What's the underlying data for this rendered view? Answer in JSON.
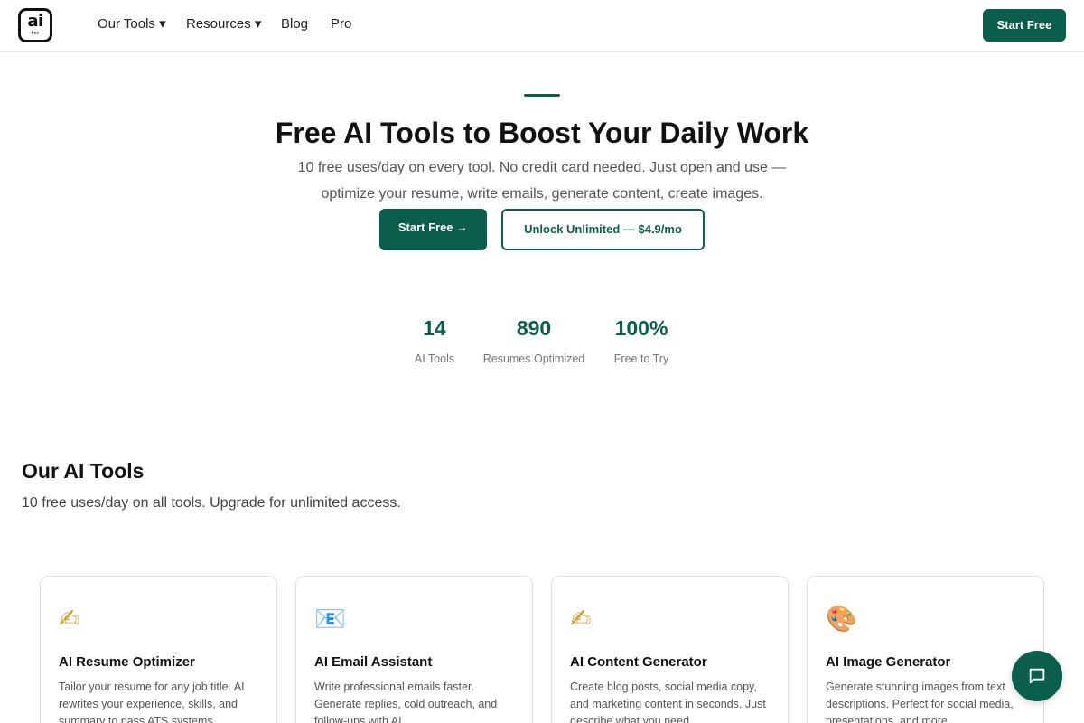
{
  "brand": {
    "logo_text": "ai",
    "logo_sub": "free"
  },
  "nav": {
    "items": [
      {
        "label": "Our Tools ▾"
      },
      {
        "label": "Resources ▾"
      },
      {
        "label": "Blog"
      },
      {
        "label": "Pro"
      }
    ],
    "cta_label": "Start Free"
  },
  "hero": {
    "title": "Free AI Tools to Boost Your Daily Work",
    "subtitle_line1": "10 free uses/day on every tool. No credit card needed. Just open and use —",
    "subtitle_line2": "optimize your resume, write emails, generate content, create images.",
    "primary_label": "Start Free →",
    "secondary_label": "Unlock Unlimited — $4.9/mo"
  },
  "stats": [
    {
      "value": "14",
      "label": "AI Tools"
    },
    {
      "value": "890",
      "label": "Resumes Optimized"
    },
    {
      "value": "100%",
      "label": "Free to Try"
    }
  ],
  "tools_section": {
    "title": "Our AI Tools",
    "subtitle": "10 free uses/day on all tools. Upgrade for unlimited access."
  },
  "cards": [
    {
      "icon": "writing-hand-icon",
      "glyph": "✍",
      "title": "AI Resume Optimizer",
      "desc": "Tailor your resume for any job title. AI rewrites your experience, skills, and summary to pass ATS systems."
    },
    {
      "icon": "email-icon",
      "glyph": "📧",
      "title": "AI Email Assistant",
      "desc": "Write professional emails faster. Generate replies, cold outreach, and follow-ups with AI."
    },
    {
      "icon": "writing-hand-icon",
      "glyph": "✍",
      "title": "AI Content Generator",
      "desc": "Create blog posts, social media copy, and marketing content in seconds. Just describe what you need."
    },
    {
      "icon": "palette-icon",
      "glyph": "🎨",
      "title": "AI Image Generator",
      "desc": "Generate stunning images from text descriptions. Perfect for social media, presentations, and more."
    }
  ],
  "chat": {
    "icon": "chat-bubble-icon"
  },
  "colors": {
    "accent": "#0b5e4b",
    "text": "#111111",
    "muted": "#555555",
    "border": "#dedede"
  }
}
